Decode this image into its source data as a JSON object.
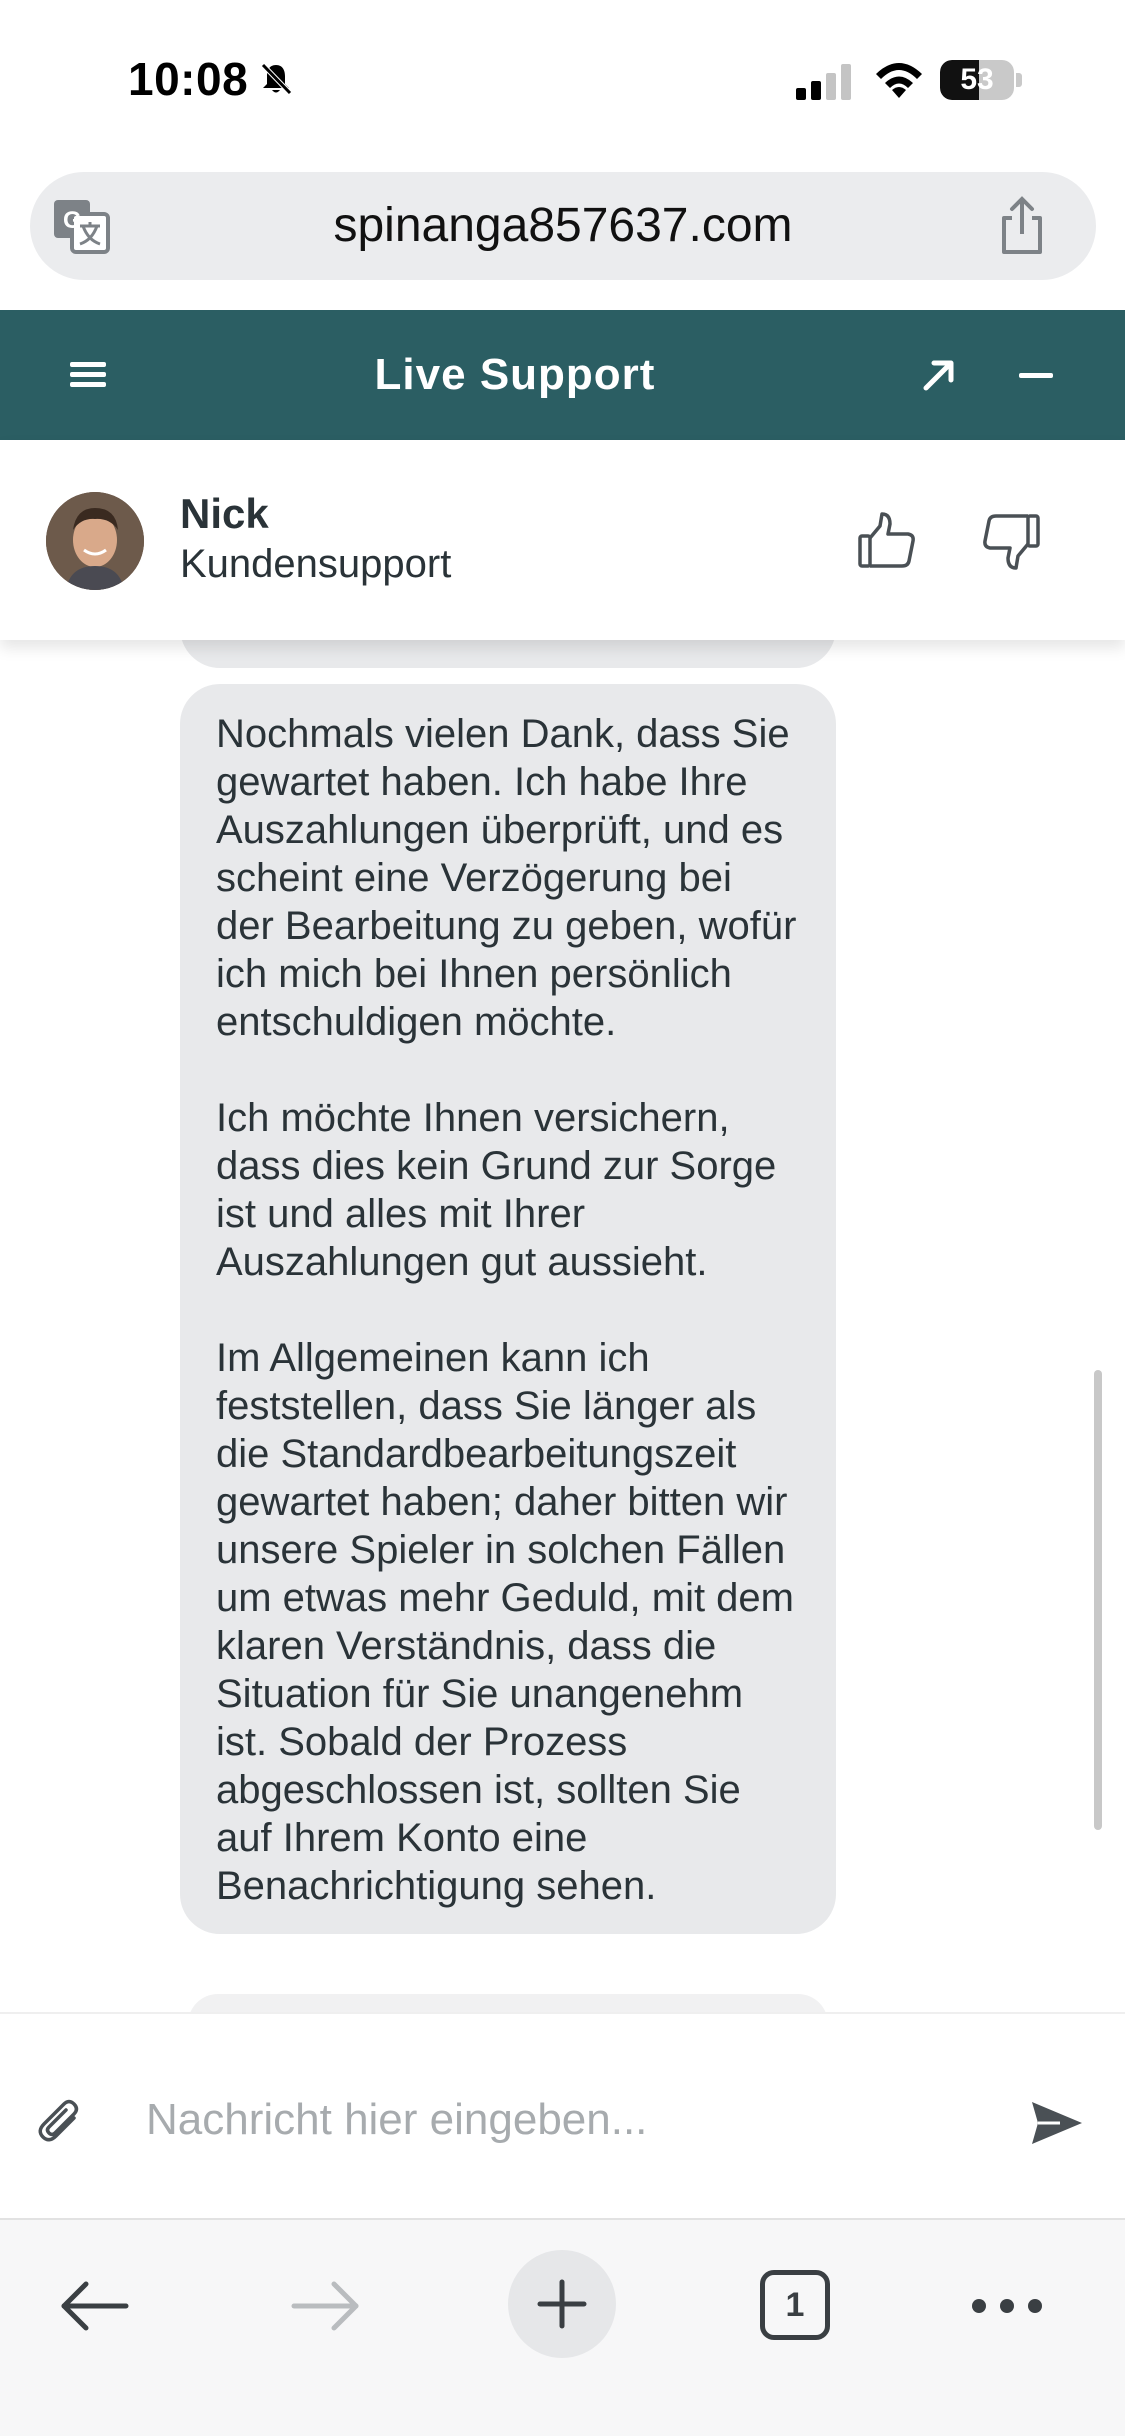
{
  "status_bar": {
    "time": "10:08",
    "battery_level": "53",
    "icons": [
      "bell-slash-icon",
      "signal-icon",
      "wifi-icon",
      "battery-icon"
    ]
  },
  "browser": {
    "url": "spinanga857637.com",
    "translate_icon": "translate-icon",
    "share_icon": "share-icon"
  },
  "chat_header": {
    "title": "Live Support",
    "icons": [
      "menu-icon",
      "expand-icon",
      "minimize-icon"
    ],
    "color": "#2b5e63"
  },
  "agent": {
    "name": "Nick",
    "role": "Kundensupport",
    "feedback_icons": [
      "thumbs-up-icon",
      "thumbs-down-icon"
    ]
  },
  "messages": [
    {
      "sender": "agent",
      "text": "Nochmals vielen Dank, dass Sie gewartet haben. Ich habe Ihre Auszahlungen überprüft, und es scheint eine Verzögerung bei der Bearbeitung zu geben, wofür ich mich bei Ihnen persönlich entschuldigen möchte.\n\nIch möchte Ihnen versichern, dass dies kein Grund zur Sorge ist und alles mit Ihrer Auszahlungen gut aussieht.\n\nIm Allgemeinen kann ich feststellen, dass Sie länger als die Standardbearbeitungszeit gewartet haben; daher bitten wir unsere Spieler in solchen Fällen um etwas mehr Geduld, mit dem klaren Verständnis, dass die Situation für Sie unangenehm ist. Sobald der Prozess abgeschlossen ist, sollten Sie auf Ihrem Konto eine Benachrichtigung sehen."
    }
  ],
  "composer": {
    "placeholder": "Nachricht hier eingeben...",
    "value": ""
  },
  "toolbar": {
    "tab_count": "1",
    "icons": [
      "back-icon",
      "forward-icon",
      "plus-icon",
      "tabs-icon",
      "more-icon"
    ]
  }
}
